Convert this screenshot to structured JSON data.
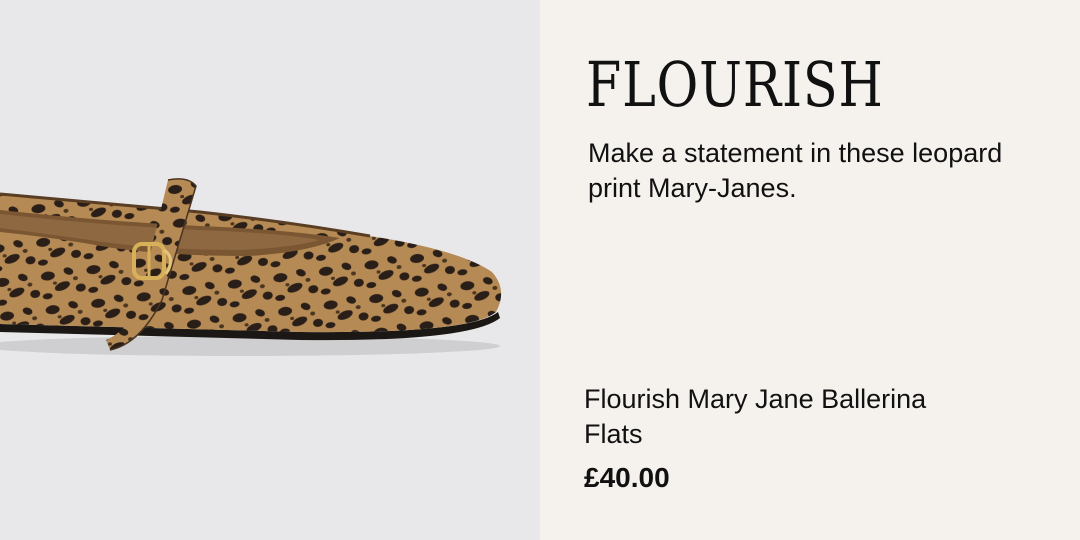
{
  "banner": {
    "brand": "FLOURISH",
    "tagline": "Make a statement in these leopard print Mary-Janes.",
    "product": {
      "name": "Flourish Mary Jane Ballerina Flats",
      "price": "£40.00"
    },
    "image": {
      "subject": "leopard-print-mary-jane-flat",
      "colors": {
        "background": "#e8e8ea",
        "panel": "#f5f2ee",
        "leopard_base": "#b68a54",
        "leopard_spot": "#2a1f18",
        "buckle": "#d6b15a"
      }
    }
  }
}
